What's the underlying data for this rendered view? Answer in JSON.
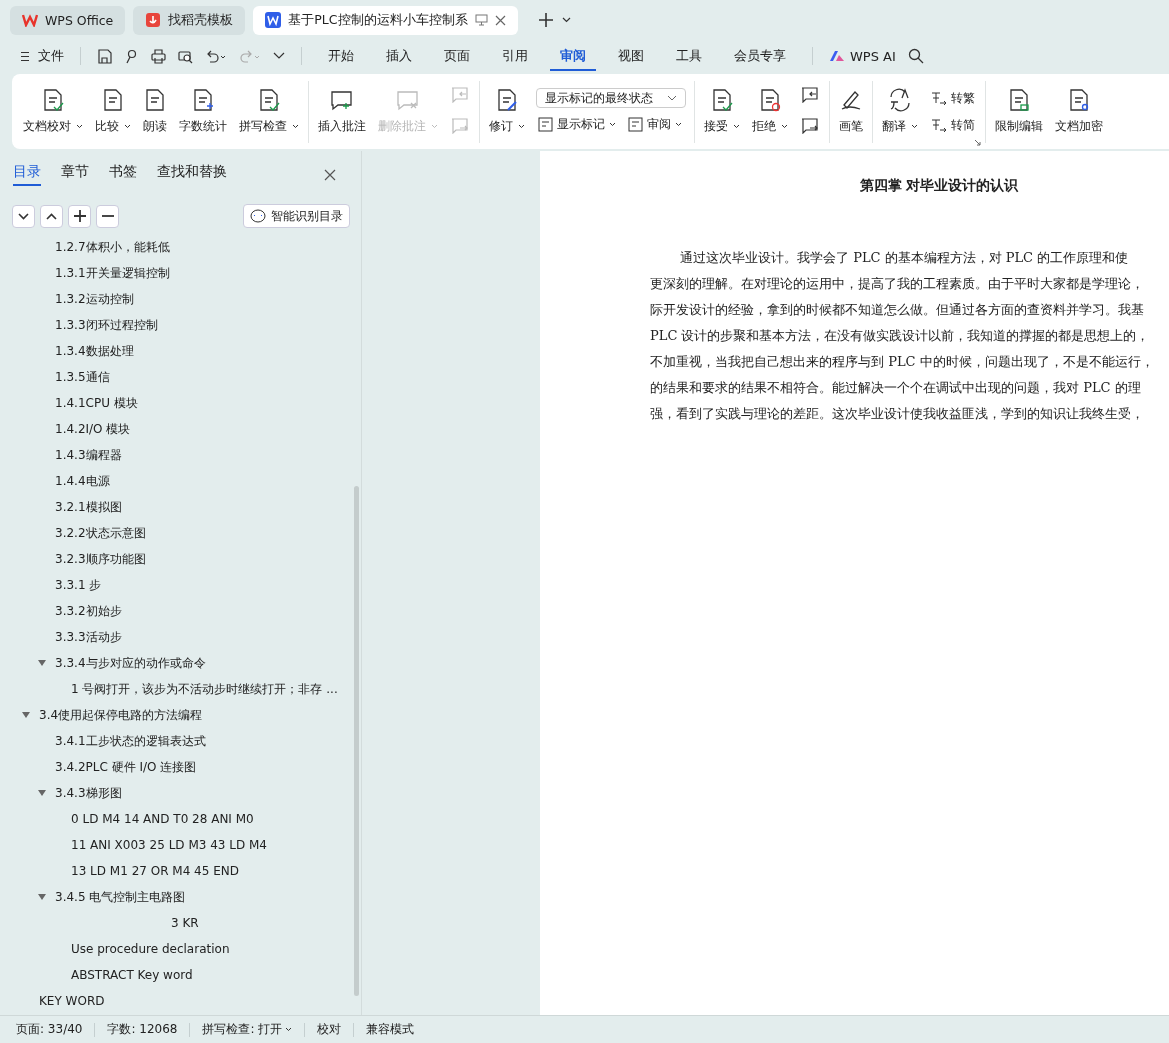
{
  "title_tabs": [
    {
      "label": "WPS Office",
      "kind": "home",
      "selected": false
    },
    {
      "label": "找稻壳模板",
      "kind": "template",
      "selected": false
    },
    {
      "label": "基于PLC控制的运料小车控制系",
      "kind": "document",
      "selected": true
    }
  ],
  "menu": {
    "file_label": "文件",
    "tabs": [
      {
        "label": "开始",
        "selected": false
      },
      {
        "label": "插入",
        "selected": false
      },
      {
        "label": "页面",
        "selected": false
      },
      {
        "label": "引用",
        "selected": false
      },
      {
        "label": "审阅",
        "selected": true
      },
      {
        "label": "视图",
        "selected": false
      },
      {
        "label": "工具",
        "selected": false
      },
      {
        "label": "会员专享",
        "selected": false
      }
    ],
    "ai_label": "WPS AI"
  },
  "ribbon": [
    {
      "items": [
        {
          "kind": "large",
          "label": "文档校对",
          "caret": true,
          "disabled": false
        },
        {
          "kind": "large",
          "label": "比较",
          "caret": true,
          "disabled": false
        },
        {
          "kind": "large",
          "label": "朗读",
          "caret": false,
          "disabled": false
        },
        {
          "kind": "large",
          "label": "字数统计",
          "caret": false,
          "disabled": false
        },
        {
          "kind": "large",
          "label": "拼写检查",
          "caret": true,
          "disabled": false
        }
      ]
    },
    {
      "items": [
        {
          "kind": "large",
          "label": "插入批注",
          "caret": false,
          "disabled": false
        },
        {
          "kind": "large",
          "label": "删除批注",
          "caret": true,
          "disabled": true
        },
        {
          "kind": "stack",
          "buttons": [
            {
              "disabled": true
            },
            {
              "disabled": true
            }
          ]
        }
      ]
    },
    {
      "items": [
        {
          "kind": "large",
          "label": "修订",
          "caret": true,
          "disabled": false
        },
        {
          "kind": "select",
          "value": "显示标记的最终状态",
          "buttons": [
            {
              "label": "显示标记",
              "caret": true
            },
            {
              "label": "审阅",
              "caret": true
            }
          ]
        }
      ]
    },
    {
      "items": [
        {
          "kind": "large",
          "label": "接受",
          "caret": true,
          "disabled": false
        },
        {
          "kind": "large",
          "label": "拒绝",
          "caret": true,
          "disabled": false
        },
        {
          "kind": "stack",
          "buttons": [
            {
              "disabled": false
            },
            {
              "disabled": false
            }
          ]
        }
      ]
    },
    {
      "items": [
        {
          "kind": "large",
          "label": "画笔",
          "caret": false,
          "disabled": false
        }
      ]
    },
    {
      "items": [
        {
          "kind": "large",
          "label": "翻译",
          "caret": true,
          "disabled": false
        },
        {
          "kind": "labeled-stack",
          "buttons": [
            {
              "label": "转繁"
            },
            {
              "label": "转简"
            }
          ]
        }
      ]
    },
    {
      "items": [
        {
          "kind": "large",
          "label": "限制编辑",
          "caret": false,
          "disabled": false
        },
        {
          "kind": "large",
          "label": "文档加密",
          "caret": false,
          "disabled": false
        }
      ]
    }
  ],
  "sidebar": {
    "tabs": [
      {
        "label": "目录",
        "selected": true
      },
      {
        "label": "章节",
        "selected": false
      },
      {
        "label": "书签",
        "selected": false
      },
      {
        "label": "查找和替换",
        "selected": false
      }
    ],
    "smart_button": "智能识别目录",
    "toc_continued": [
      {
        "label": "1.2.7体积小，能耗低"
      },
      {
        "label": "1.3.1开关量逻辑控制"
      },
      {
        "label": "1.3.2运动控制"
      },
      {
        "label": "1.3.3闭环过程控制"
      },
      {
        "label": "1.3.4数据处理"
      },
      {
        "label": "1.3.5通信"
      },
      {
        "label": "1.4.1CPU 模块"
      },
      {
        "label": "1.4.2I/O 模块"
      },
      {
        "label": "1.4.3编程器"
      },
      {
        "label": "1.4.4电源"
      },
      {
        "label": "3.2.1模拟图"
      },
      {
        "label": "3.2.2状态示意图"
      },
      {
        "label": "3.2.3顺序功能图"
      },
      {
        "label": "3.3.1 步"
      },
      {
        "label": "3.3.2初始步"
      },
      {
        "label": "3.3.3活动步"
      },
      {
        "label": "3.3.4与步对应的动作或命令",
        "expanded": true,
        "children": [
          {
            "label": "1 号阀打开，该步为不活动步时继续打开；非存 ..."
          }
        ]
      }
    ],
    "toc": [
      {
        "label": "3.4使用起保停电路的方法编程",
        "expanded": true,
        "children": [
          {
            "label": "3.4.1工步状态的逻辑表达式"
          },
          {
            "label": "3.4.2PLC 硬件 I/O 连接图"
          },
          {
            "label": "3.4.3梯形图",
            "expanded": true,
            "children": [
              {
                "label": "0 LD M4 14 AND T0 28 ANI M0"
              },
              {
                "label": "11 ANI X003 25 LD M3 43 LD M4"
              },
              {
                "label": "13 LD M1 27 OR M4 45 END"
              }
            ]
          },
          {
            "label": "3.4.5 电气控制主电路图",
            "expanded": true,
            "children": [
              {
                "label": "3 KR",
                "kind": "centered"
              },
              {
                "label": "Use procedure declaration"
              },
              {
                "label": "ABSTRACT Key word"
              }
            ]
          }
        ]
      },
      {
        "label": "KEY WORD"
      }
    ]
  },
  "document": {
    "heading": "第四掌  对毕业设计的认识",
    "lines": [
      "通过这次毕业设计。我学会了 PLC 的基本编程方法，对 PLC 的工作原理和使",
      "更深刻的理解。在对理论的运用中，提高了我的工程素质。由于平时大家都是学理论，",
      "际开发设计的经验，拿到的时候都不知道怎么做。但通过各方面的查资料并学习。我基",
      "PLC 设计的步聚和基本方法，在没有做实践设计以前，我知道的撑握的都是思想上的，",
      "不加重视，当我把自己想出来的程序与到 PLC 中的时候，问题出现了，不是不能运行，",
      "的结果和要求的结果不相符合。能过解决一个个在调试中出现的问题，我对 PLC 的理",
      "强，看到了实践与理论的差距。这次毕业设计使我收益匪浅，学到的知识让我终生受，"
    ]
  },
  "status_bar": [
    {
      "label": "页面: 33/40",
      "caret": false
    },
    {
      "label": "字数: 12068",
      "caret": false
    },
    {
      "label": "拼写检查: 打开",
      "caret": true
    },
    {
      "label": "校对",
      "caret": false
    },
    {
      "label": "兼容模式",
      "caret": false
    }
  ]
}
